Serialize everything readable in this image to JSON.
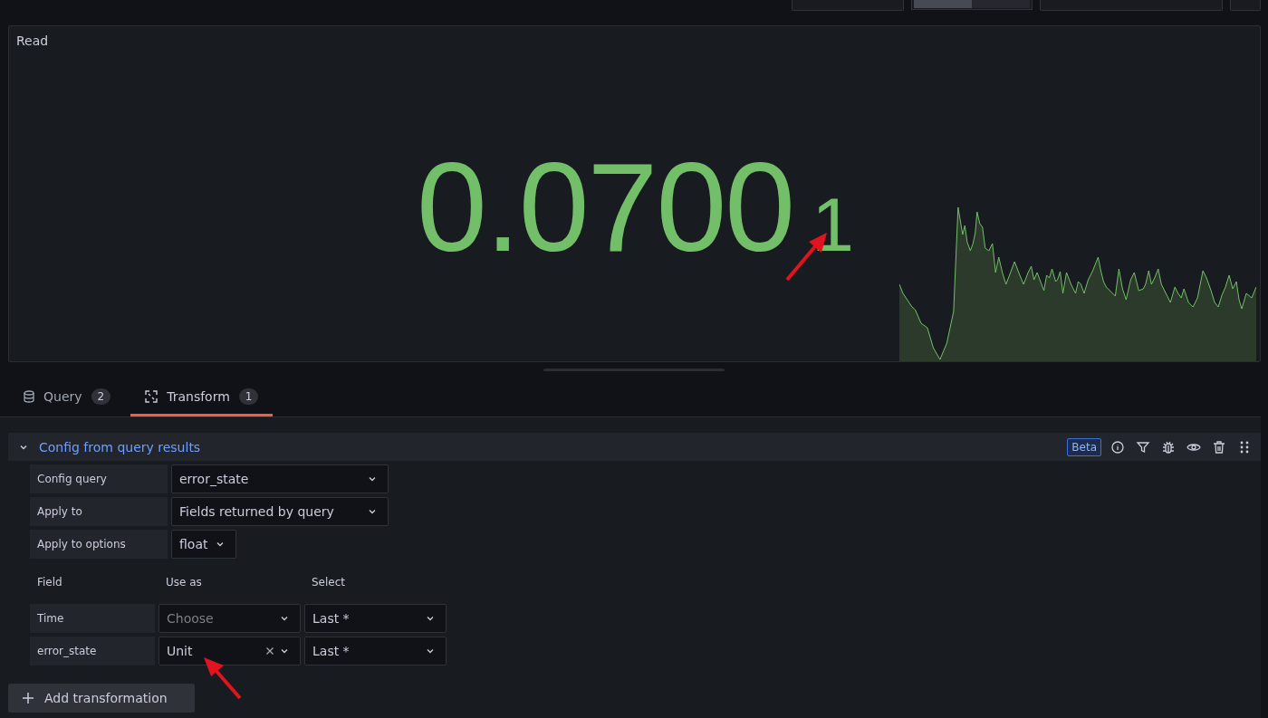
{
  "toolbar": {
    "view_modes": [
      {
        "selected": true
      },
      {
        "selected": false
      }
    ]
  },
  "panel": {
    "title": "Read",
    "value": "0.0700",
    "suffix": "1"
  },
  "tabs": [
    {
      "label": "Query",
      "count": "2",
      "kind": "database",
      "selected": false
    },
    {
      "label": "Transform",
      "count": "1",
      "kind": "transform",
      "selected": true
    }
  ],
  "transformation": {
    "title": "Config from query results",
    "expanded": true,
    "badge": "Beta",
    "options": [
      {
        "label": "Config query",
        "value": "error_state",
        "wide": true
      },
      {
        "label": "Apply to",
        "value": "Fields returned by query",
        "wide": true
      },
      {
        "label": "Apply to options",
        "value": "float",
        "wide": false
      }
    ],
    "mapping_columns": [
      "Field",
      "Use as",
      "Select"
    ],
    "mapping_rows": [
      {
        "field": "Time",
        "use_as": {
          "placeholder": "Choose",
          "clearable": false
        },
        "select": "Last *"
      },
      {
        "field": "error_state",
        "use_as": {
          "value": "Unit",
          "clearable": true
        },
        "select": "Last *"
      }
    ]
  },
  "add_button": "Add transformation"
}
